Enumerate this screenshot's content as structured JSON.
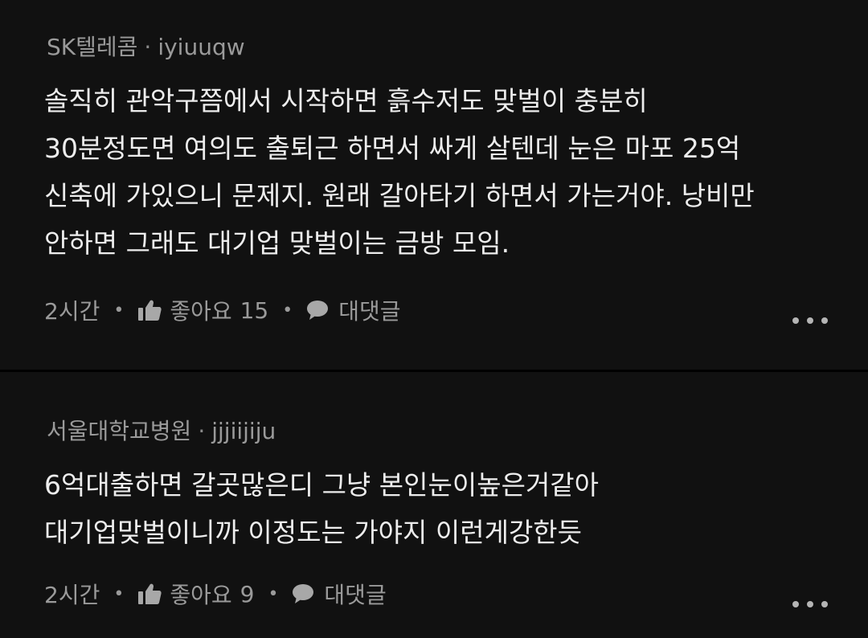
{
  "colors": {
    "background": "#111111",
    "separator": "#000000",
    "text_primary": "#ededed",
    "text_secondary": "#9a9a9a"
  },
  "comments": [
    {
      "company": "SK텔레콤",
      "separator": "·",
      "username": "iyiuuqw",
      "lines": [
        "솔직히 관악구쯤에서 시작하면 흙수저도 맞벌이 충분히",
        "30분정도면 여의도 출퇴근 하면서 싸게 살텐데 눈은 마포 25억",
        "신축에 가있으니 문제지. 원래 갈아타기 하면서 가는거야. 낭비만",
        "안하면 그래도 대기업 맞벌이는 금방 모임."
      ],
      "time": "2시간",
      "like_label": "좋아요",
      "like_count": "15",
      "reply_label": "대댓글",
      "like_icon": "thumbs-up-icon",
      "reply_icon": "speech-bubble-icon",
      "more_icon": "more-horizontal-icon"
    },
    {
      "company": "서울대학교병원",
      "separator": "·",
      "username": "jjjiijiju",
      "lines": [
        "6억대출하면 갈곳많은디 그냥 본인눈이높은거같아",
        "대기업맞벌이니까 이정도는 가야지 이런게강한듯"
      ],
      "time": "2시간",
      "like_label": "좋아요",
      "like_count": "9",
      "reply_label": "대댓글",
      "like_icon": "thumbs-up-icon",
      "reply_icon": "speech-bubble-icon",
      "more_icon": "more-horizontal-icon"
    }
  ]
}
